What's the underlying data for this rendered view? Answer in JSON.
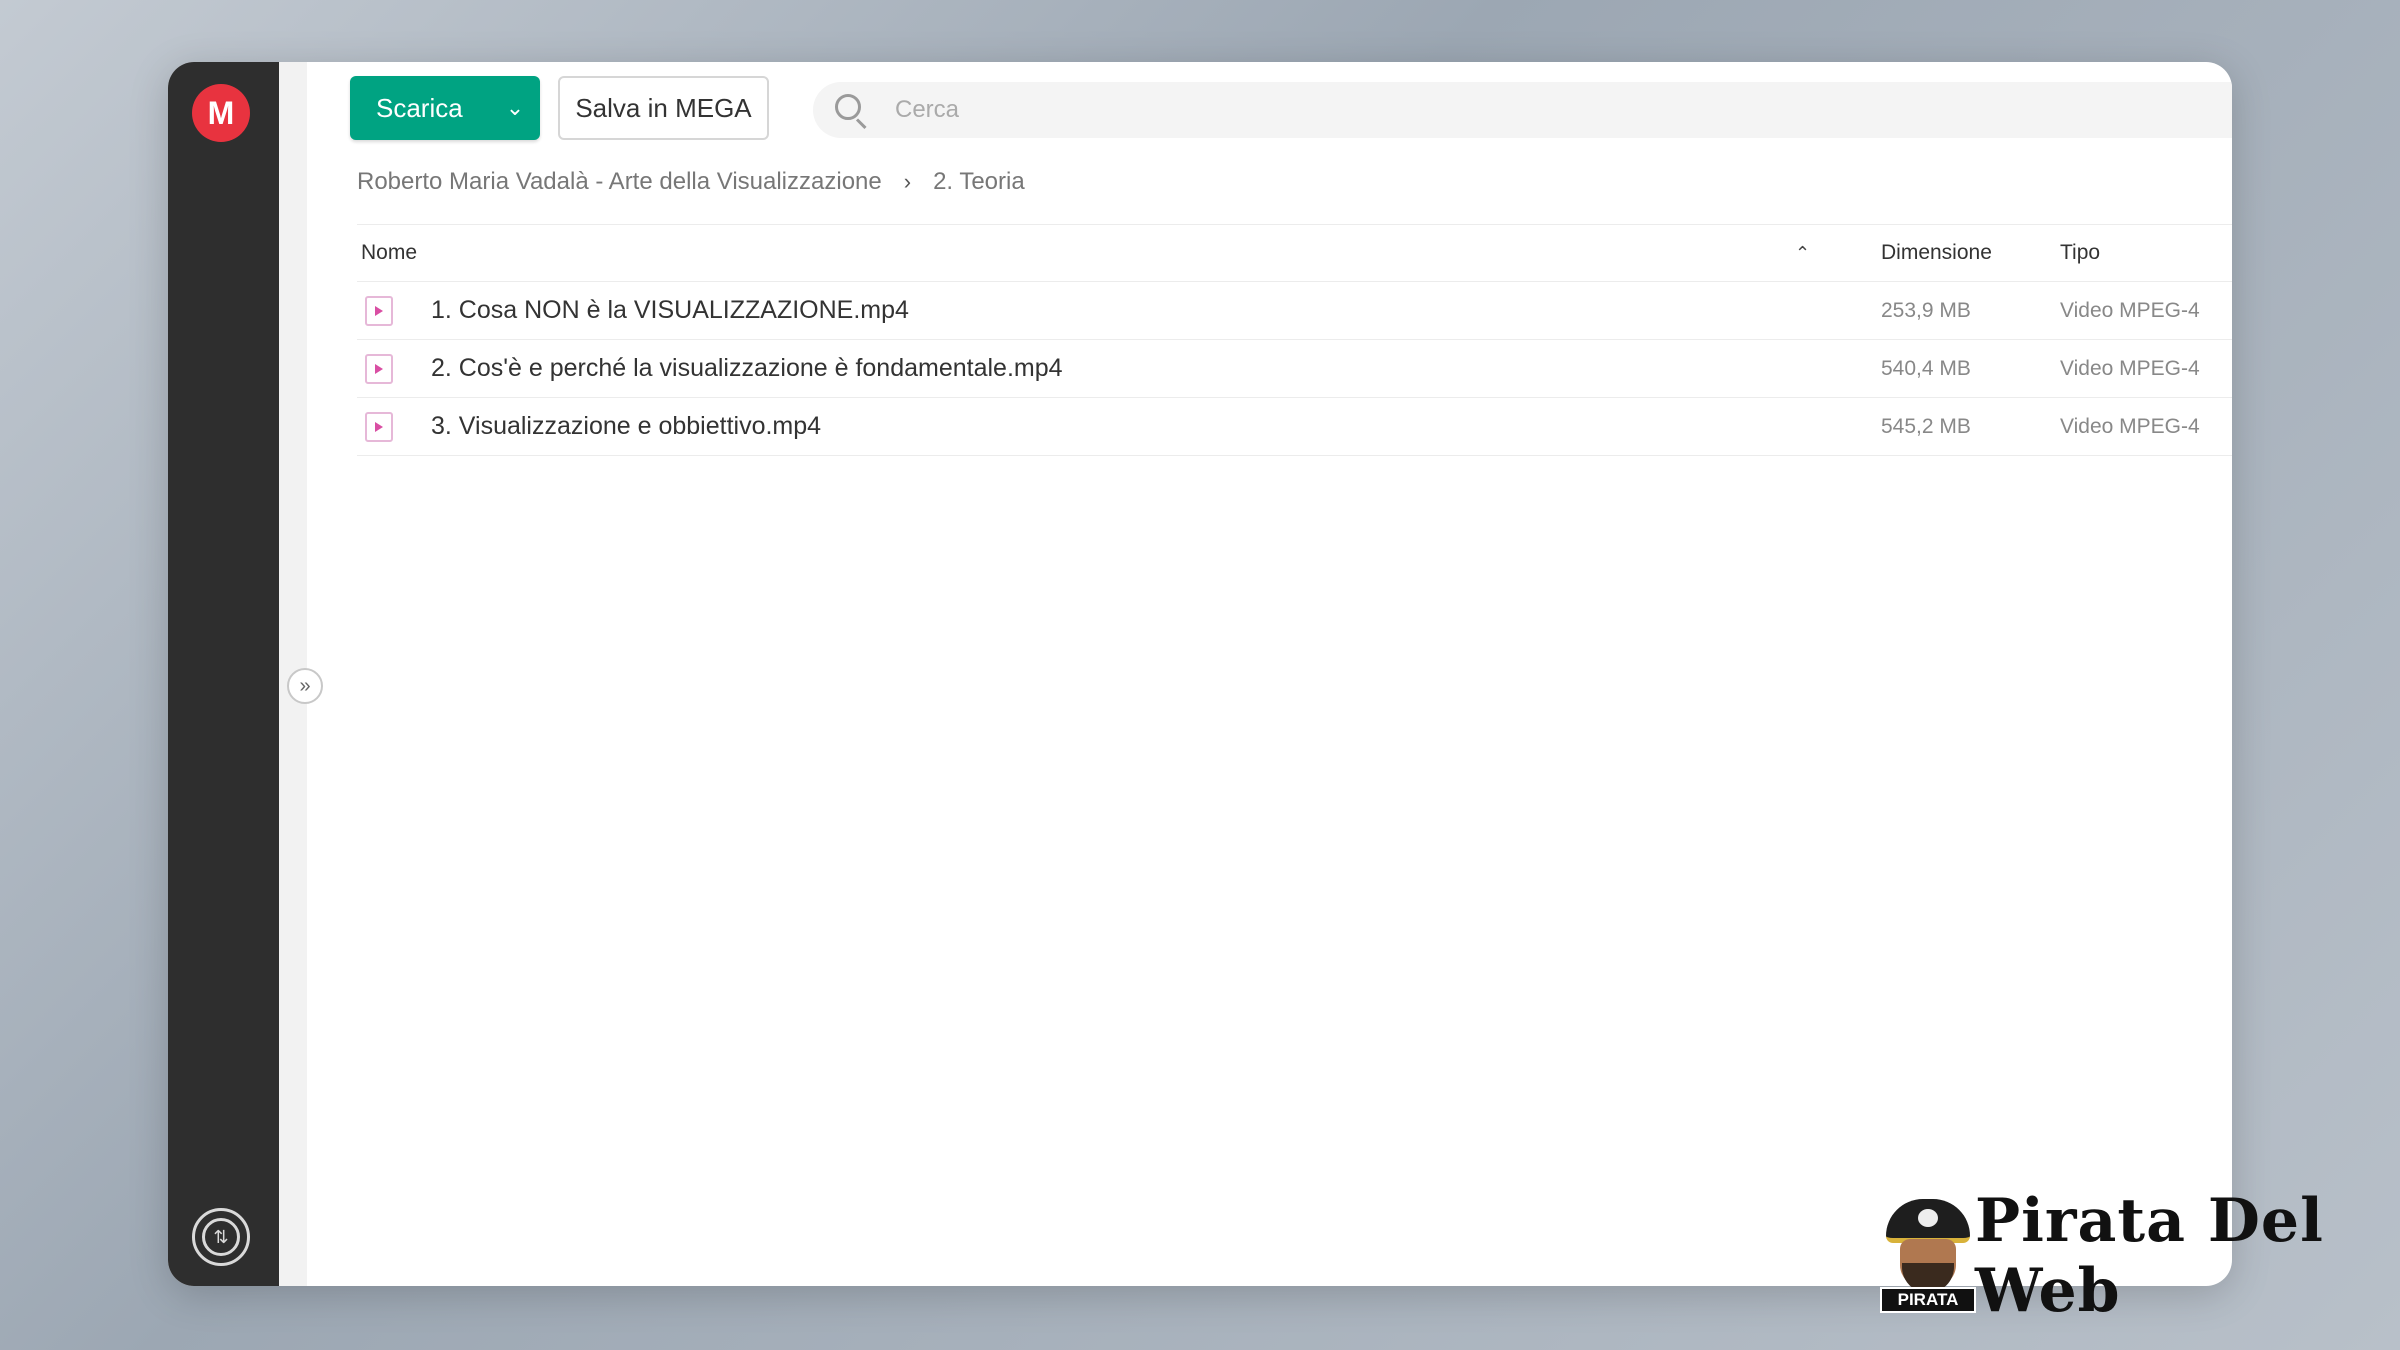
{
  "sidebar": {
    "logo_letter": "M",
    "transfer_icon": "transfer-arrows-icon"
  },
  "toolbar": {
    "download_label": "Scarica",
    "save_label": "Salva in MEGA"
  },
  "search": {
    "placeholder": "Cerca",
    "value": ""
  },
  "breadcrumb": {
    "items": [
      {
        "label": "Roberto Maria Vadalà - Arte della Visualizzazione"
      },
      {
        "label": "2. Teoria"
      }
    ]
  },
  "table": {
    "headers": {
      "name": "Nome",
      "size": "Dimensione",
      "type": "Tipo"
    },
    "rows": [
      {
        "name": "1. Cosa NON è la VISUALIZZAZIONE.mp4",
        "size": "253,9 MB",
        "type": "Video MPEG-4"
      },
      {
        "name": "2. Cos'è e perché la visualizzazione è fondamentale.mp4",
        "size": "540,4 MB",
        "type": "Video MPEG-4"
      },
      {
        "name": "3. Visualizzazione e obbiettivo.mp4",
        "size": "545,2 MB",
        "type": "Video MPEG-4"
      }
    ]
  },
  "watermark": {
    "brand": "Pirata Del Web",
    "badge": "PIRATA"
  },
  "colors": {
    "accent": "#00a382",
    "logo": "#e8333f",
    "sidebar": "#2e2e2e"
  }
}
